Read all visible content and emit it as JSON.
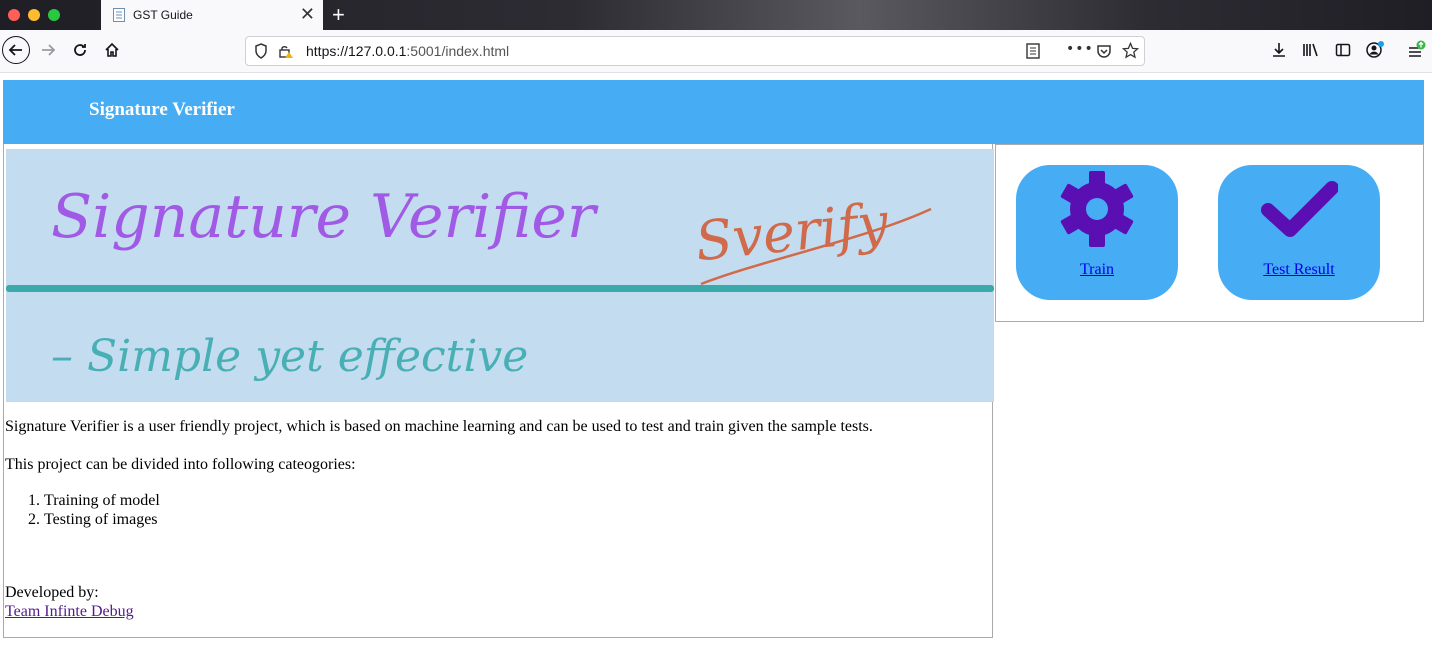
{
  "browser": {
    "tab_title": "GST Guide",
    "tab_close": "✕",
    "new_tab": "+",
    "url_host": "https://127.0.0.1",
    "url_rest": ":5001/index.html"
  },
  "header": {
    "brand": "Signature Verifier"
  },
  "banner": {
    "line1": "Signature Verifier",
    "signature": "Sverify",
    "line2": "– Simple yet effective"
  },
  "content": {
    "intro": "Signature Verifier is a user friendly project, which is based on machine learning and can be used to test and train given the sample tests.",
    "categories_intro": "This project can be divided into following cateogories:",
    "categories": [
      "Training of model",
      "Testing of images"
    ],
    "developed_by": "Developed by:",
    "team_link": "Team Infinte Debug"
  },
  "actions": {
    "train": "Train",
    "test_result": "Test Result"
  },
  "colors": {
    "header": "#46adf5",
    "icon": "#5a0fb3",
    "banner_bg": "#c4dcf0"
  }
}
